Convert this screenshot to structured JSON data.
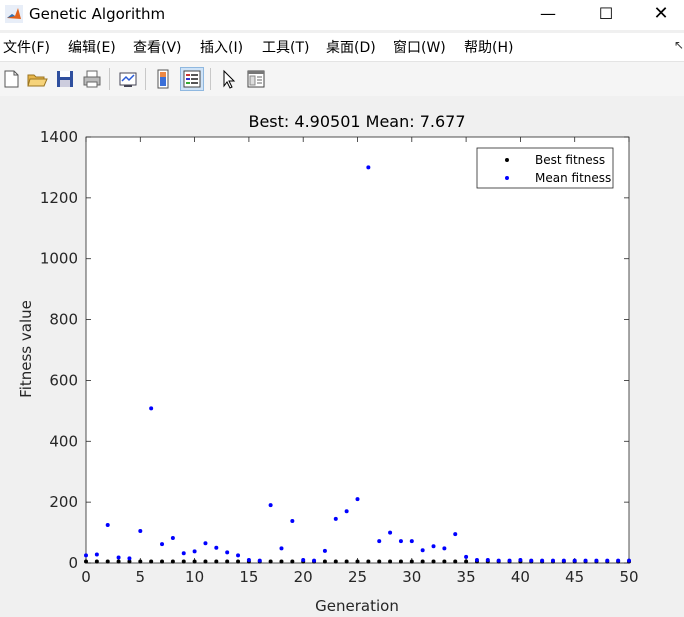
{
  "window": {
    "title": "Genetic Algorithm",
    "minimize_glyph": "—",
    "maximize_glyph": "☐",
    "close_glyph": "✕"
  },
  "menu": {
    "items": [
      {
        "label": "文件(F)"
      },
      {
        "label": "编辑(E)"
      },
      {
        "label": "查看(V)"
      },
      {
        "label": "插入(I)"
      },
      {
        "label": "工具(T)"
      },
      {
        "label": "桌面(D)"
      },
      {
        "label": "窗口(W)"
      },
      {
        "label": "帮助(H)"
      }
    ],
    "overflow_glyph": "↖"
  },
  "toolbar": {
    "icons": [
      "new-figure-icon",
      "open-file-icon",
      "save-icon",
      "print-icon",
      "link-plot-icon",
      "colorbar-icon",
      "legend-icon",
      "pointer-icon",
      "property-inspector-icon"
    ]
  },
  "colors": {
    "best": "#000000",
    "mean": "#0000ff",
    "axes_bg": "#ffffff",
    "figure_bg": "#f0f0f0"
  },
  "chart_data": {
    "type": "scatter",
    "title": "Best: 4.90501 Mean: 7.677",
    "xlabel": "Generation",
    "ylabel": "Fitness value",
    "xlim": [
      0,
      50
    ],
    "ylim": [
      0,
      1400
    ],
    "xticks": [
      0,
      5,
      10,
      15,
      20,
      25,
      30,
      35,
      40,
      45,
      50
    ],
    "yticks": [
      0,
      200,
      400,
      600,
      800,
      1000,
      1200,
      1400
    ],
    "grid": false,
    "legend_position": "top-right",
    "x": [
      0,
      1,
      2,
      3,
      4,
      5,
      6,
      7,
      8,
      9,
      10,
      11,
      12,
      13,
      14,
      15,
      16,
      17,
      18,
      19,
      20,
      21,
      22,
      23,
      24,
      25,
      26,
      27,
      28,
      29,
      30,
      31,
      32,
      33,
      34,
      35,
      36,
      37,
      38,
      39,
      40,
      41,
      42,
      43,
      44,
      45,
      46,
      47,
      48,
      49,
      50
    ],
    "series": [
      {
        "name": "Best fitness",
        "color": "#000000",
        "values": [
          5,
          5,
          5,
          5,
          5,
          5,
          5,
          5,
          5,
          5,
          5,
          5,
          5,
          5,
          5,
          5,
          5,
          5,
          5,
          5,
          5,
          5,
          5,
          5,
          5,
          5,
          5,
          5,
          5,
          5,
          5,
          5,
          5,
          5,
          5,
          5,
          5,
          5,
          5,
          5,
          5,
          5,
          5,
          5,
          5,
          5,
          5,
          5,
          5,
          5,
          5
        ]
      },
      {
        "name": "Mean fitness",
        "color": "#0000ff",
        "values": [
          25,
          28,
          125,
          18,
          15,
          105,
          508,
          62,
          82,
          32,
          38,
          65,
          50,
          35,
          25,
          10,
          8,
          190,
          48,
          138,
          10,
          8,
          40,
          145,
          170,
          210,
          1300,
          72,
          100,
          72,
          72,
          42,
          55,
          48,
          95,
          20,
          10,
          10,
          8,
          8,
          10,
          8,
          8,
          8,
          8,
          8,
          8,
          8,
          8,
          8,
          8
        ]
      }
    ]
  }
}
